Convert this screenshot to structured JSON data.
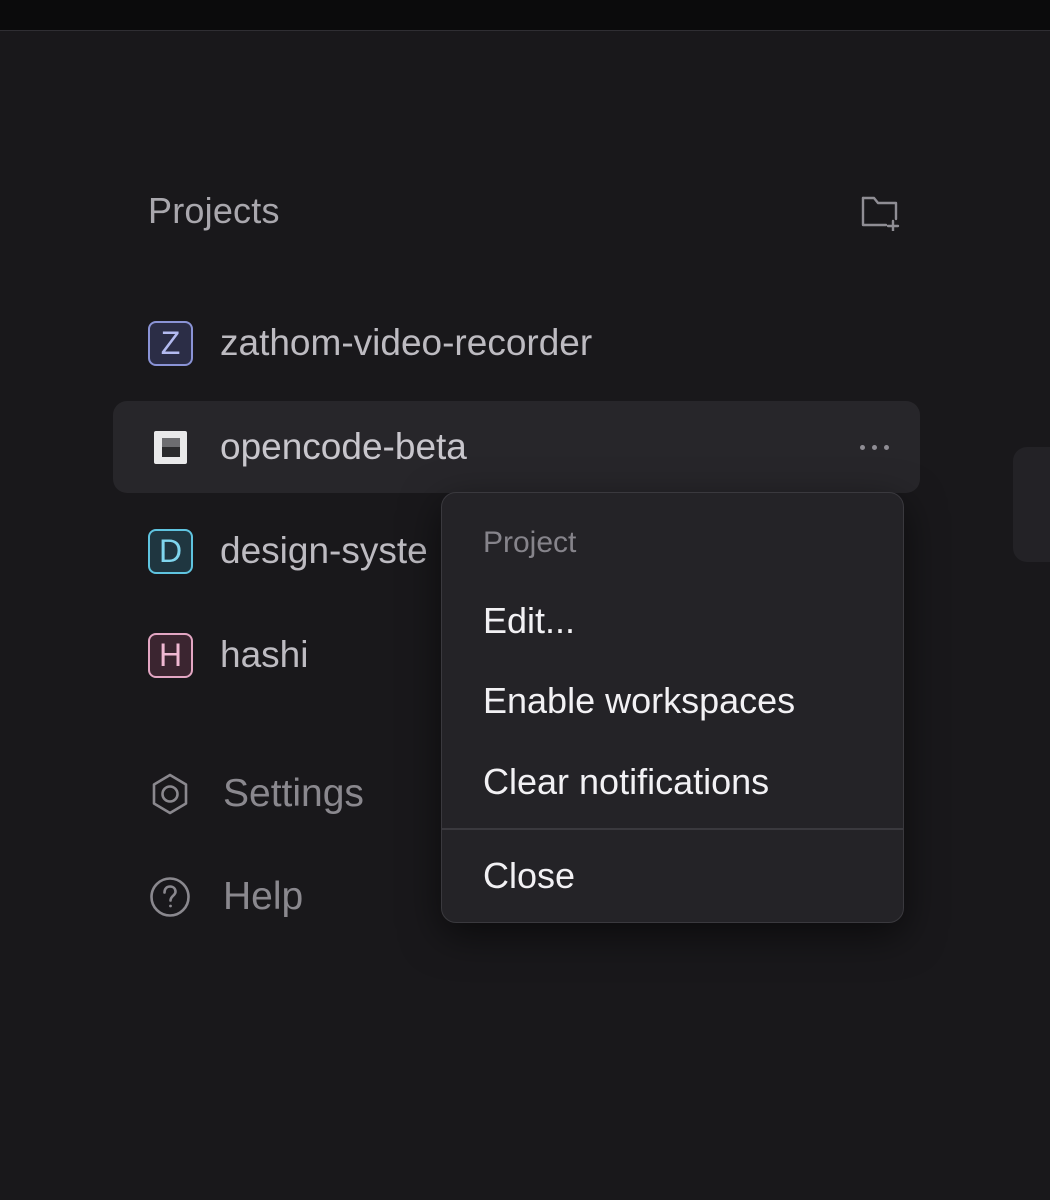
{
  "sidebar": {
    "title": "Projects",
    "new_project_icon": "folder-plus-icon",
    "projects": [
      {
        "initial": "Z",
        "name": "zathom-video-recorder",
        "color": "#8a93d6"
      },
      {
        "initial": "",
        "name": "opencode-beta",
        "color": "#e9e9ea",
        "active": true
      },
      {
        "initial": "D",
        "name": "design-syste",
        "color": "#5fc4e0"
      },
      {
        "initial": "H",
        "name": "hashi",
        "color": "#e3a6c3"
      }
    ],
    "nav": [
      {
        "icon": "hexagon-settings-icon",
        "label": "Settings"
      },
      {
        "icon": "help-circle-icon",
        "label": "Help"
      }
    ]
  },
  "context_menu": {
    "header": "Project",
    "items": [
      "Edit...",
      "Enable workspaces",
      "Clear notifications"
    ],
    "footer_item": "Close"
  }
}
